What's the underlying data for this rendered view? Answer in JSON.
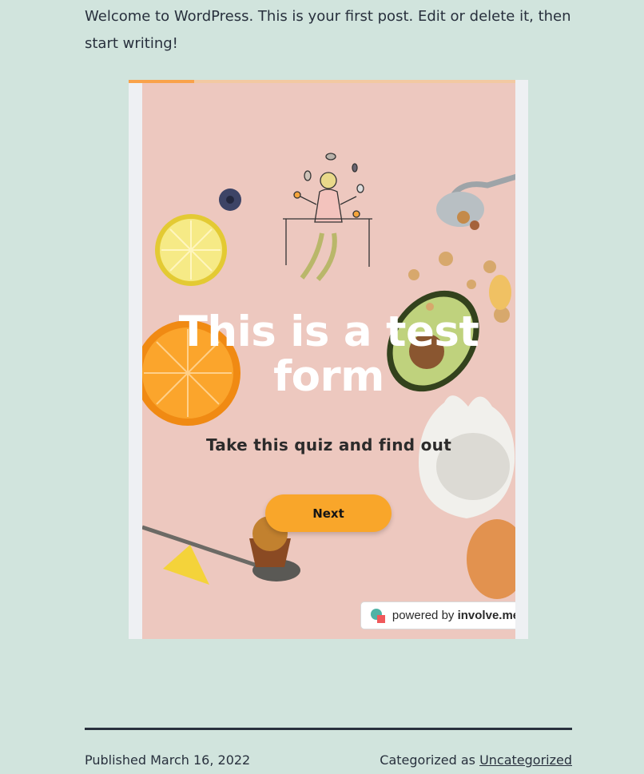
{
  "post": {
    "intro": "Welcome to WordPress. This is your first post. Edit or delete it, then start writing!"
  },
  "form": {
    "progress": 0.17,
    "title_line1": "This is a test",
    "title_line2": "form",
    "subtitle": "Take this quiz and find out",
    "next_label": "Next",
    "powered_prefix": "powered by",
    "powered_brand": "involve.me"
  },
  "footer": {
    "published_label": "Published",
    "published_date": "March 16, 2022",
    "category_label": "Categorized as",
    "category_link": "Uncategorized"
  },
  "colors": {
    "page_bg": "#d1e4dd",
    "slide_bg": "#edc8bf",
    "accent": "#f9a62a",
    "text": "#28303d"
  },
  "icons": [
    "involve-me-logo-icon"
  ]
}
